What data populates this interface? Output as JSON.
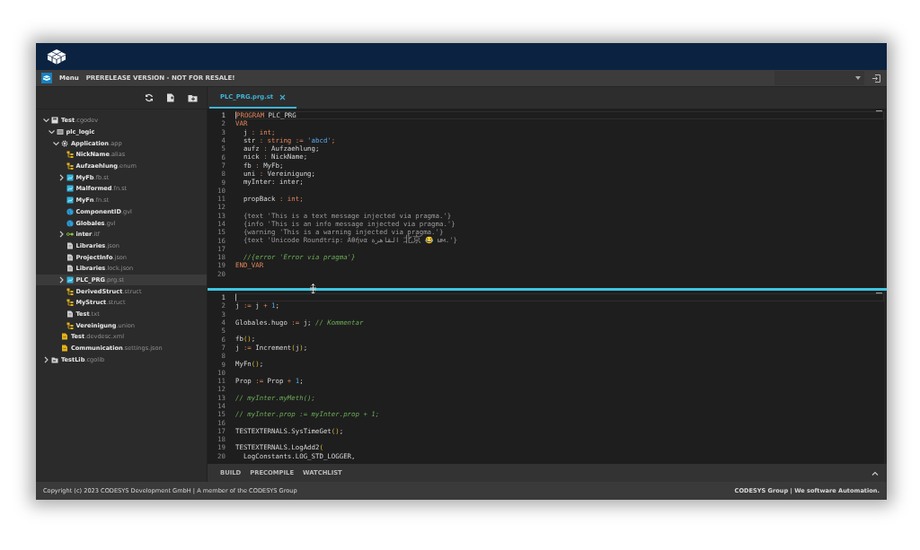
{
  "header": {
    "menu_label": "Menu",
    "notice": "PRERELEASE VERSION - NOT FOR RESALE!"
  },
  "tree": [
    {
      "name": "Test",
      "ext": ".cgodev",
      "kind": "project",
      "expanded": true,
      "selected": false,
      "children": [
        {
          "name": "plc_logic",
          "kind": "module",
          "expanded": true,
          "selected": false,
          "children": [
            {
              "name": "Application",
              "ext": ".app",
              "kind": "app",
              "expanded": true,
              "selected": false,
              "children": [
                {
                  "name": "NickName",
                  "ext": ".alias",
                  "kind": "struct",
                  "selected": false
                },
                {
                  "name": "Aufzaehlung",
                  "ext": ".enum",
                  "kind": "struct",
                  "selected": false
                },
                {
                  "name": "MyFb",
                  "ext": ".fb.st",
                  "kind": "st",
                  "expanded": false,
                  "selected": false
                },
                {
                  "name": "Malformed",
                  "ext": ".fn.st",
                  "kind": "st",
                  "selected": false
                },
                {
                  "name": "MyFn",
                  "ext": ".fn.st",
                  "kind": "st",
                  "selected": false
                },
                {
                  "name": "ComponentID",
                  "ext": ".gvl",
                  "kind": "gvl",
                  "selected": false
                },
                {
                  "name": "Globales",
                  "ext": ".gvl",
                  "kind": "gvl",
                  "selected": false
                },
                {
                  "name": "inter",
                  "ext": ".itf",
                  "kind": "itf",
                  "expanded": false,
                  "selected": false
                },
                {
                  "name": "Libraries",
                  "ext": ".json",
                  "kind": "file",
                  "selected": false
                },
                {
                  "name": "ProjectInfo",
                  "ext": ".json",
                  "kind": "file",
                  "selected": false
                },
                {
                  "name": "Libraries",
                  "ext": ".lock.json",
                  "kind": "file",
                  "selected": false
                },
                {
                  "name": "PLC_PRG",
                  "ext": ".prg.st",
                  "kind": "st",
                  "expanded": false,
                  "selected": true
                },
                {
                  "name": "DerivedStruct",
                  "ext": ".struct",
                  "kind": "struct",
                  "selected": false
                },
                {
                  "name": "MyStruct",
                  "ext": ".struct",
                  "kind": "struct",
                  "selected": false
                },
                {
                  "name": "Test",
                  "ext": ".txt",
                  "kind": "file",
                  "selected": false
                },
                {
                  "name": "Vereinigung",
                  "ext": ".union",
                  "kind": "struct",
                  "selected": false
                }
              ]
            },
            {
              "name": "Test",
              "ext": ".devdesc.xml",
              "kind": "device",
              "selected": false
            },
            {
              "name": "Communication",
              "ext": ".settings.json",
              "kind": "device",
              "selected": false
            }
          ]
        }
      ]
    },
    {
      "name": "TestLib",
      "ext": ".cgolib",
      "kind": "folder",
      "expanded": false,
      "selected": false
    }
  ],
  "tabs": [
    {
      "label": "PLC_PRG.prg.st",
      "selected": true
    }
  ],
  "panes": [
    {
      "lines": [
        {
          "n": "1",
          "current": true,
          "tokens": [
            {
              "text": "PROGRAM",
              "kind": "kw"
            },
            {
              "text": " PLC_PRG",
              "kind": "id"
            }
          ]
        },
        {
          "n": "2",
          "current": false,
          "tokens": [
            {
              "text": "VAR",
              "kind": "kw"
            }
          ]
        },
        {
          "n": "3",
          "current": false,
          "tokens": [
            {
              "text": "  j ",
              "kind": "id"
            },
            {
              "text": ": int;",
              "kind": "type"
            }
          ]
        },
        {
          "n": "4",
          "current": false,
          "tokens": [
            {
              "text": "  str ",
              "kind": "id"
            },
            {
              "text": ": string :=",
              "kind": "type"
            },
            {
              "text": " 'abcd'",
              "kind": "str"
            },
            {
              "text": ";",
              "kind": "type"
            }
          ]
        },
        {
          "n": "5",
          "current": false,
          "tokens": [
            {
              "text": "  aufz ",
              "kind": "id"
            },
            {
              "text": ":",
              "kind": "type"
            },
            {
              "text": " Aufzaehlung;",
              "kind": "id"
            }
          ]
        },
        {
          "n": "6",
          "current": false,
          "tokens": [
            {
              "text": "  nick ",
              "kind": "id"
            },
            {
              "text": ":",
              "kind": "type"
            },
            {
              "text": " NickName;",
              "kind": "id"
            }
          ]
        },
        {
          "n": "7",
          "current": false,
          "tokens": [
            {
              "text": "  fb ",
              "kind": "id"
            },
            {
              "text": ":",
              "kind": "type"
            },
            {
              "text": " MyFb;",
              "kind": "id"
            }
          ]
        },
        {
          "n": "8",
          "current": false,
          "tokens": [
            {
              "text": "  uni ",
              "kind": "id"
            },
            {
              "text": ":",
              "kind": "type"
            },
            {
              "text": " Vereinigung;",
              "kind": "id"
            }
          ]
        },
        {
          "n": "9",
          "current": false,
          "tokens": [
            {
              "text": "  myInter: inter;",
              "kind": "id"
            }
          ]
        },
        {
          "n": "10",
          "current": false
        },
        {
          "n": "11",
          "current": false,
          "tokens": [
            {
              "text": "  propBack ",
              "kind": "id"
            },
            {
              "text": ": int;",
              "kind": "type"
            }
          ]
        },
        {
          "n": "12",
          "current": false
        },
        {
          "n": "13",
          "current": false,
          "tokens": [
            {
              "text": "  {text 'This is a text message injected via pragma.'}",
              "kind": "pragma"
            }
          ]
        },
        {
          "n": "14",
          "current": false,
          "tokens": [
            {
              "text": "  {info 'This is an info message injected via pragma.'}",
              "kind": "pragma"
            }
          ]
        },
        {
          "n": "15",
          "current": false,
          "tokens": [
            {
              "text": "  {warning 'This is a warning injected via pragma.'}",
              "kind": "pragma"
            }
          ]
        },
        {
          "n": "16",
          "current": false,
          "tokens": [
            {
              "text": "  {text 'Unicode Roundtrip: Αθήνα القاهرة 北京 😂 ωм.'}",
              "kind": "pragma"
            }
          ]
        },
        {
          "n": "17",
          "current": false
        },
        {
          "n": "18",
          "current": false,
          "tokens": [
            {
              "text": "  //{error 'Error via pragma'}",
              "kind": "comment"
            }
          ]
        },
        {
          "n": "19",
          "current": false,
          "tokens": [
            {
              "text": "END_VAR",
              "kind": "kw"
            }
          ]
        },
        {
          "n": "20",
          "current": false
        }
      ]
    },
    {
      "lines": [
        {
          "n": "1",
          "current": true
        },
        {
          "n": "2",
          "current": false,
          "tokens": [
            {
              "text": "j ",
              "kind": "id"
            },
            {
              "text": ":=",
              "kind": "op"
            },
            {
              "text": " j ",
              "kind": "id"
            },
            {
              "text": "+",
              "kind": "op"
            },
            {
              "text": " 1",
              "kind": "num"
            },
            {
              "text": ";",
              "kind": "id"
            }
          ]
        },
        {
          "n": "3",
          "current": false
        },
        {
          "n": "4",
          "current": false,
          "tokens": [
            {
              "text": "Globales.hugo ",
              "kind": "id"
            },
            {
              "text": ":=",
              "kind": "op"
            },
            {
              "text": " j; ",
              "kind": "id"
            },
            {
              "text": "// Kommentar",
              "kind": "comment"
            }
          ]
        },
        {
          "n": "5",
          "current": false
        },
        {
          "n": "6",
          "current": false,
          "tokens": [
            {
              "text": "fb",
              "kind": "id"
            },
            {
              "text": "()",
              "kind": "paren"
            },
            {
              "text": ";",
              "kind": "id"
            }
          ]
        },
        {
          "n": "7",
          "current": false,
          "tokens": [
            {
              "text": "j ",
              "kind": "id"
            },
            {
              "text": ":=",
              "kind": "op"
            },
            {
              "text": " Increment",
              "kind": "id"
            },
            {
              "text": "(",
              "kind": "paren"
            },
            {
              "text": "j",
              "kind": "id"
            },
            {
              "text": ")",
              "kind": "paren"
            },
            {
              "text": ";",
              "kind": "id"
            }
          ]
        },
        {
          "n": "8",
          "current": false
        },
        {
          "n": "9",
          "current": false,
          "tokens": [
            {
              "text": "MyFn",
              "kind": "id"
            },
            {
              "text": "()",
              "kind": "paren"
            },
            {
              "text": ";",
              "kind": "id"
            }
          ]
        },
        {
          "n": "10",
          "current": false
        },
        {
          "n": "11",
          "current": false,
          "tokens": [
            {
              "text": "Prop ",
              "kind": "id"
            },
            {
              "text": ":=",
              "kind": "op"
            },
            {
              "text": " Prop ",
              "kind": "id"
            },
            {
              "text": "+",
              "kind": "op"
            },
            {
              "text": " 1",
              "kind": "num"
            },
            {
              "text": ";",
              "kind": "id"
            }
          ]
        },
        {
          "n": "12",
          "current": false
        },
        {
          "n": "13",
          "current": false,
          "tokens": [
            {
              "text": "// myInter.myMeth();",
              "kind": "comment"
            }
          ]
        },
        {
          "n": "14",
          "current": false
        },
        {
          "n": "15",
          "current": false,
          "tokens": [
            {
              "text": "// myInter.prop := myInter.prop + 1;",
              "kind": "comment"
            }
          ]
        },
        {
          "n": "16",
          "current": false
        },
        {
          "n": "17",
          "current": false,
          "tokens": [
            {
              "text": "TESTEXTERNALS.SysTimeGet",
              "kind": "id"
            },
            {
              "text": "()",
              "kind": "paren"
            },
            {
              "text": ";",
              "kind": "id"
            }
          ]
        },
        {
          "n": "18",
          "current": false
        },
        {
          "n": "19",
          "current": false,
          "tokens": [
            {
              "text": "TESTEXTERNALS.LogAdd2",
              "kind": "id"
            },
            {
              "text": "(",
              "kind": "paren"
            }
          ]
        },
        {
          "n": "20",
          "current": false,
          "tokens": [
            {
              "text": "  LogConstants.LOG_STD_LOGGER,",
              "kind": "id"
            }
          ]
        }
      ]
    }
  ],
  "bottom_tabs": [
    {
      "label": "BUILD",
      "selected": false
    },
    {
      "label": "PRECOMPILE",
      "selected": false
    },
    {
      "label": "WATCHLIST",
      "selected": false
    }
  ],
  "footer": {
    "copyright": "Copyright (c) 2023 CODESYS Development GmbH | A member of the CODESYS Group",
    "slogan": "CODESYS Group | We software Automation."
  }
}
